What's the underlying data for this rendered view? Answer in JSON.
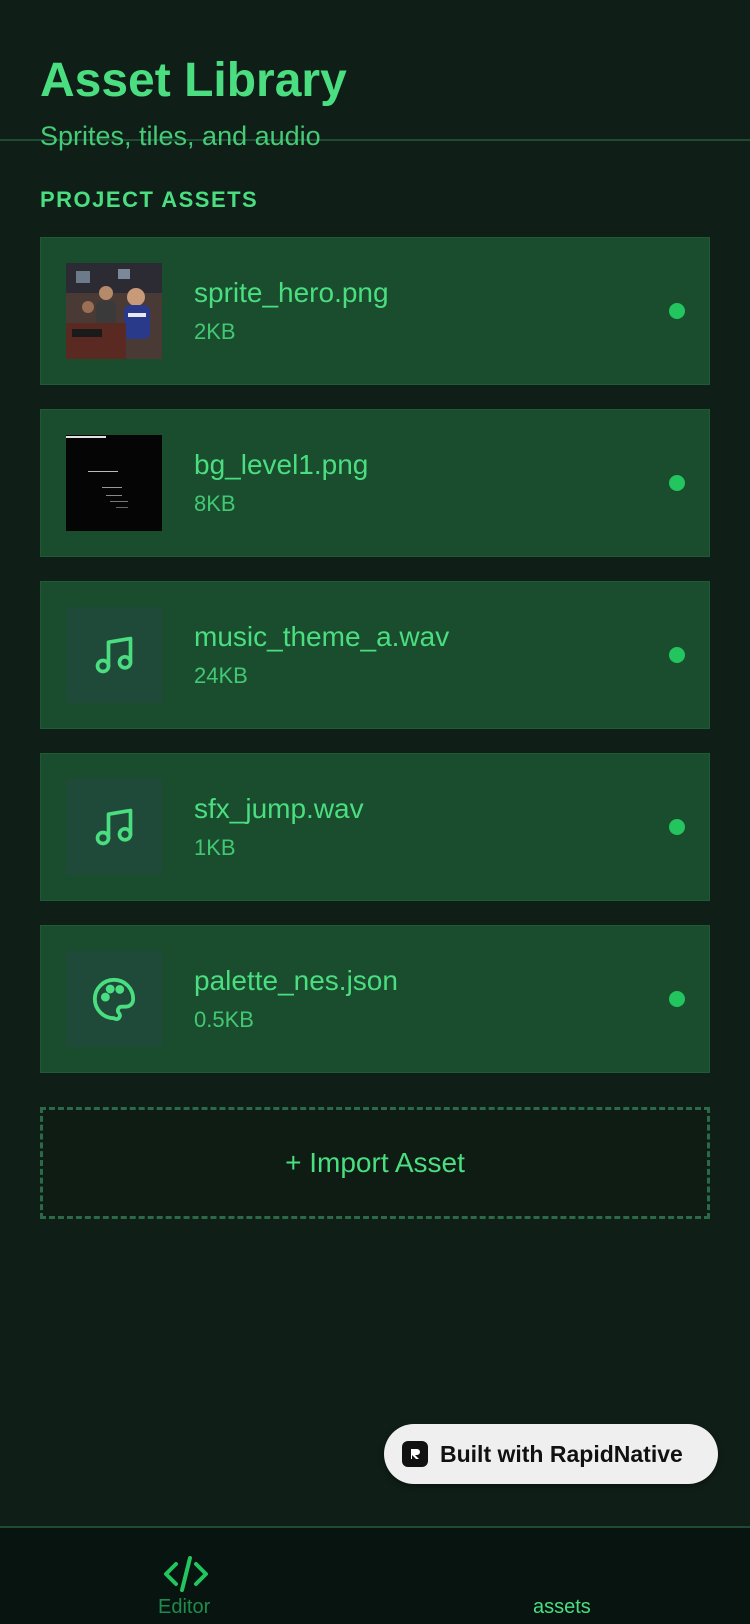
{
  "header": {
    "title": "Asset Library",
    "subtitle": "Sprites, tiles, and audio"
  },
  "section": {
    "label": "PROJECT ASSETS"
  },
  "assets": [
    {
      "name": "sprite_hero.png",
      "size": "2KB",
      "thumb": "photo-thumbnail"
    },
    {
      "name": "bg_level1.png",
      "size": "8KB",
      "thumb": "dark-image-thumbnail"
    },
    {
      "name": "music_theme_a.wav",
      "size": "24KB",
      "thumb": "music-note-icon"
    },
    {
      "name": "sfx_jump.wav",
      "size": "1KB",
      "thumb": "music-note-icon"
    },
    {
      "name": "palette_nes.json",
      "size": "0.5KB",
      "thumb": "palette-icon"
    }
  ],
  "import_button": {
    "label": "+ Import Asset"
  },
  "badge": {
    "label": "Built with RapidNative"
  },
  "tabbar": {
    "tabs": [
      {
        "label": "Editor",
        "icon": "code-icon"
      },
      {
        "label": "assets"
      }
    ]
  },
  "colors": {
    "background": "#0f1e17",
    "card": "#1a4d2e",
    "accent": "#4ade80",
    "status_dot": "#22c55e"
  }
}
